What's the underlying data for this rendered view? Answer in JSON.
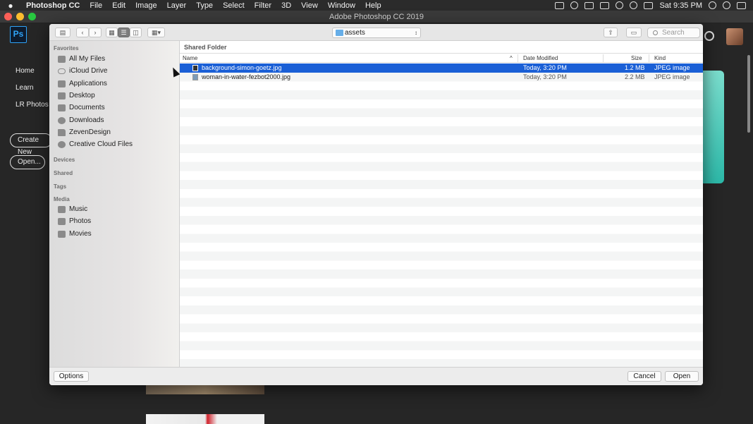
{
  "menubar": {
    "apple": "",
    "app_name": "Photoshop CC",
    "menus": [
      "File",
      "Edit",
      "Image",
      "Layer",
      "Type",
      "Select",
      "Filter",
      "3D",
      "View",
      "Window",
      "Help"
    ],
    "clock": "Sat 9:35 PM"
  },
  "window": {
    "title": "Adobe Photoshop CC 2019"
  },
  "photoshop_home": {
    "logo": "Ps",
    "nav": [
      "Home",
      "Learn",
      "LR Photos"
    ],
    "create_new_label": "Create New",
    "open_label": "Open..."
  },
  "dialog": {
    "toolbar": {
      "location": "assets",
      "search_placeholder": "Search",
      "icons": [
        "sidebar-toggle-icon",
        "back-icon",
        "forward-icon",
        "icon-view-icon",
        "list-view-icon",
        "column-view-icon",
        "gallery-view-icon",
        "share-icon",
        "tag-icon"
      ]
    },
    "sidebar": {
      "favorites_header": "Favorites",
      "favorites": [
        {
          "label": "All My Files",
          "icon": "all-files-icon"
        },
        {
          "label": "iCloud Drive",
          "icon": "cloud-icon"
        },
        {
          "label": "Applications",
          "icon": "applications-icon"
        },
        {
          "label": "Desktop",
          "icon": "desktop-icon"
        },
        {
          "label": "Documents",
          "icon": "documents-icon"
        },
        {
          "label": "Downloads",
          "icon": "downloads-icon"
        },
        {
          "label": "ZevenDesign",
          "icon": "folder-icon"
        },
        {
          "label": "Creative Cloud Files",
          "icon": "creative-cloud-icon"
        }
      ],
      "devices_header": "Devices",
      "shared_header": "Shared",
      "tags_header": "Tags",
      "media_header": "Media",
      "media": [
        {
          "label": "Music",
          "icon": "music-icon"
        },
        {
          "label": "Photos",
          "icon": "camera-icon"
        },
        {
          "label": "Movies",
          "icon": "film-icon"
        }
      ]
    },
    "file_list": {
      "section_title": "Shared Folder",
      "columns": {
        "name": "Name",
        "date": "Date Modified",
        "size": "Size",
        "kind": "Kind"
      },
      "sort_indicator": "^",
      "files": [
        {
          "name": "background-simon-goetz.jpg",
          "date": "Today, 3:20 PM",
          "size": "1.2 MB",
          "kind": "JPEG image",
          "selected": true
        },
        {
          "name": "woman-in-water-fezbot2000.jpg",
          "date": "Today, 3:20 PM",
          "size": "2.2 MB",
          "kind": "JPEG image",
          "selected": false
        }
      ]
    },
    "footer": {
      "options_label": "Options",
      "cancel_label": "Cancel",
      "open_label": "Open"
    }
  },
  "colors": {
    "selection": "#1a5fd6",
    "menubar": "#2b2b2b",
    "ps_accent": "#2fa3f7"
  }
}
